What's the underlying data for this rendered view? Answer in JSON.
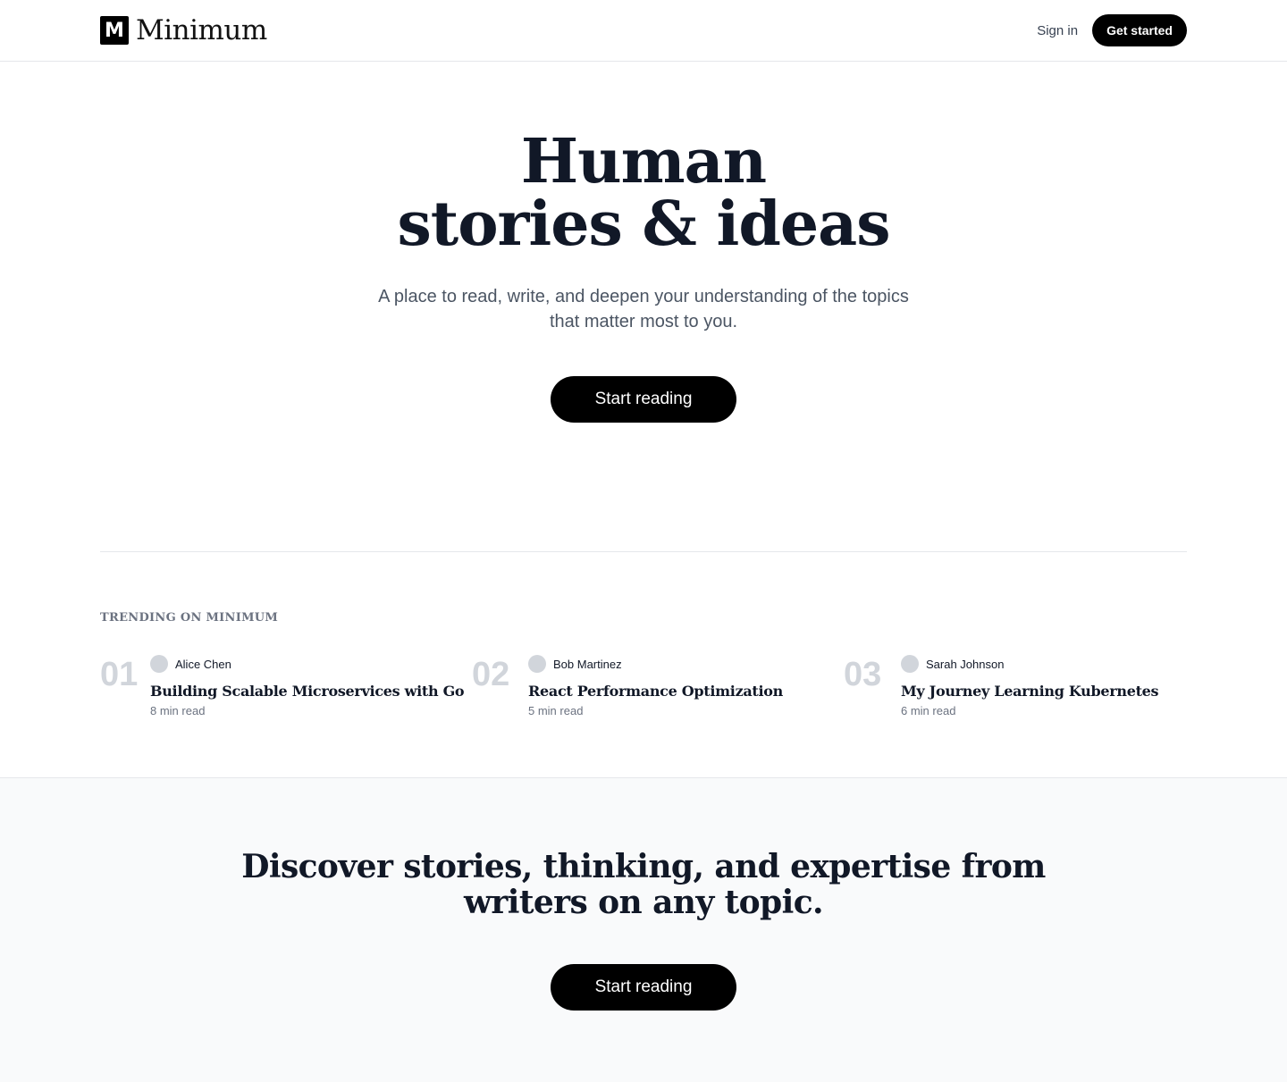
{
  "header": {
    "logo_mark": "M",
    "logo_text": "Minimum",
    "signin_label": "Sign in",
    "get_started_label": "Get started"
  },
  "hero": {
    "title_line1": "Human",
    "title_line2": "stories & ideas",
    "subtitle_line1": "A place to read, write, and deepen your understanding of the topics",
    "subtitle_line2": "that matter most to you.",
    "cta_label": "Start reading"
  },
  "trending": {
    "label": "TRENDING ON MINIMUM",
    "items": [
      {
        "num": "01",
        "author": "Alice Chen",
        "title": "Building Scalable Microservices with Go",
        "meta": "8 min read"
      },
      {
        "num": "02",
        "author": "Bob Martinez",
        "title": "React Performance Optimization",
        "meta": "5 min read"
      },
      {
        "num": "03",
        "author": "Sarah Johnson",
        "title": "My Journey Learning Kubernetes",
        "meta": "6 min read"
      }
    ]
  },
  "discover": {
    "title_line1": "Discover stories, thinking, and expertise from",
    "title_line2": "writers on any topic.",
    "cta_label": "Start reading"
  }
}
